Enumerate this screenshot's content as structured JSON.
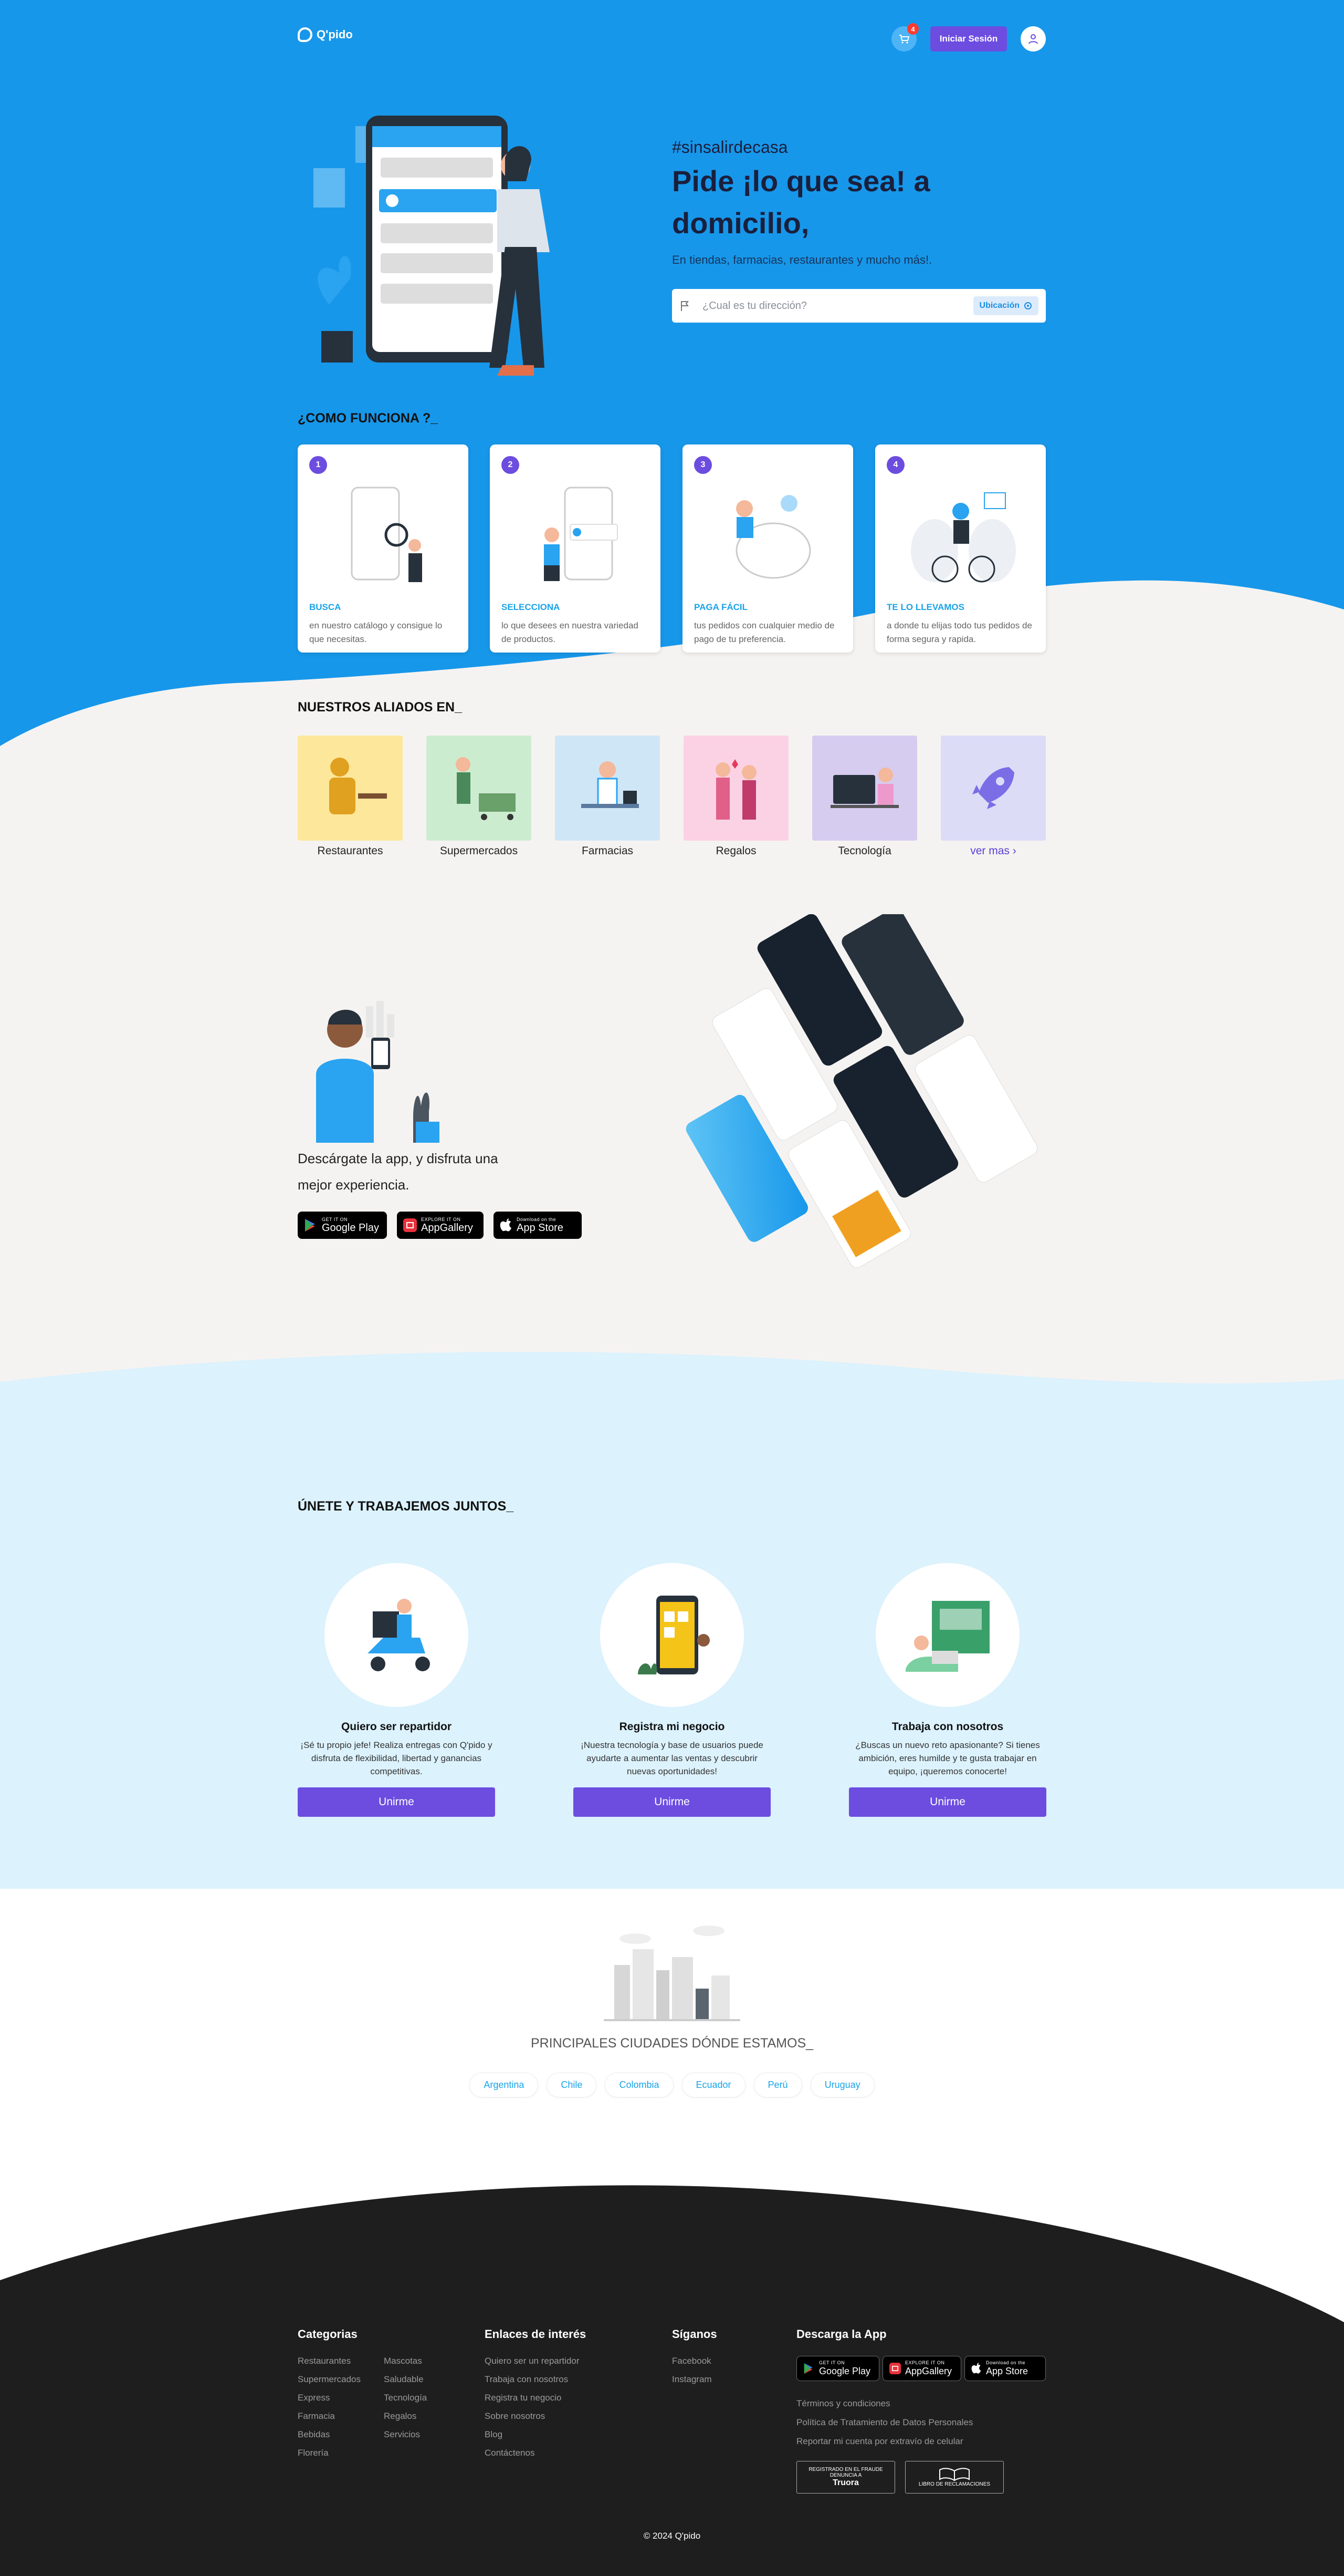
{
  "header": {
    "brand": "Q'pido",
    "cart_count": "4",
    "login_label": "Iniciar Sesión"
  },
  "hero": {
    "hashtag": "#sinsalirdecasa",
    "headline": "Pide ¡lo que sea! a domicilio,",
    "subtitle": "En tiendas, farmacias, restaurantes y mucho más!.",
    "search_placeholder": "¿Cual es tu dirección?",
    "location_button": "Ubicación"
  },
  "how": {
    "title": "¿COMO FUNCIONA ?_",
    "steps": [
      {
        "n": "1",
        "title": "BUSCA",
        "desc": "en nuestro catálogo y consigue lo que necesitas."
      },
      {
        "n": "2",
        "title": "SELECCIONA",
        "desc": "lo que desees en nuestra variedad de productos."
      },
      {
        "n": "3",
        "title": "PAGA FÁCIL",
        "desc": "tus pedidos con cualquier medio de pago de tu preferencia."
      },
      {
        "n": "4",
        "title": "TE LO LLEVAMOS",
        "desc": "a donde tu elijas todo tus pedidos de forma segura y rapida."
      }
    ]
  },
  "allies": {
    "title": "NUESTROS ALIADOS EN_",
    "items": [
      "Restaurantes",
      "Supermercados",
      "Farmacias",
      "Regalos",
      "Tecnología"
    ],
    "more": "ver mas"
  },
  "app": {
    "text": "Descárgate la app, y disfruta una mejor experiencia."
  },
  "stores": {
    "google_small": "GET IT ON",
    "google": "Google Play",
    "huawei_small": "EXPLORE IT ON",
    "huawei": "AppGallery",
    "apple_small": "Download on the",
    "apple": "App Store"
  },
  "join": {
    "title": "ÚNETE Y TRABAJEMOS JUNTOS_",
    "button": "Unirme",
    "items": [
      {
        "title": "Quiero ser repartidor",
        "desc": "¡Sé tu propio jefe! Realiza entregas con Q'pido y disfruta de flexibilidad, libertad y ganancias competitivas."
      },
      {
        "title": "Registra mi negocio",
        "desc": "¡Nuestra tecnología y base de usuarios puede ayudarte a aumentar las ventas y descubrir nuevas oportunidades!"
      },
      {
        "title": "Trabaja con nosotros",
        "desc": "¿Buscas un nuevo reto apasionante? Si tienes ambición, eres humilde y te gusta trabajar en equipo, ¡queremos conocerte!"
      }
    ]
  },
  "cities": {
    "title": "PRINCIPALES CIUDADES DÓNDE ESTAMOS_",
    "list": [
      "Argentina",
      "Chile",
      "Colombia",
      "Ecuador",
      "Perú",
      "Uruguay"
    ]
  },
  "footer": {
    "cat_title": "Categorias",
    "cat_a": [
      "Restaurantes",
      "Supermercados",
      "Express",
      "Farmacia",
      "Bebidas",
      "Florería"
    ],
    "cat_b": [
      "Mascotas",
      "Saludable",
      "Tecnología",
      "Regalos",
      "Servicios"
    ],
    "links_title": "Enlaces de interés",
    "links": [
      "Quiero ser un repartidor",
      "Trabaja con nosotros",
      "Registra tu negocio",
      "Sobre nosotros",
      "Blog",
      "Contáctenos"
    ],
    "social_title": "Síganos",
    "social": [
      "Facebook",
      "Instagram"
    ],
    "download_title": "Descarga la App",
    "legal": [
      "Términos y condiciones",
      "Política de Tratamiento de Datos Personales",
      "Reportar mi cuenta por extravío de celular"
    ],
    "seal1_a": "REGISTRADO EN EL FRAUDE",
    "seal1_b": "DENUNCIA A",
    "seal1_c": "Truora",
    "seal2": "LIBRO DE RECLAMACIONES",
    "copyright": "© 2024 Q'pido"
  },
  "colors": {
    "primary_blue": "#1797ea",
    "purple": "#6c4de0",
    "dark": "#1e1e1f",
    "light_blue": "#dcf2fd",
    "beige": "#f5f3f1"
  }
}
